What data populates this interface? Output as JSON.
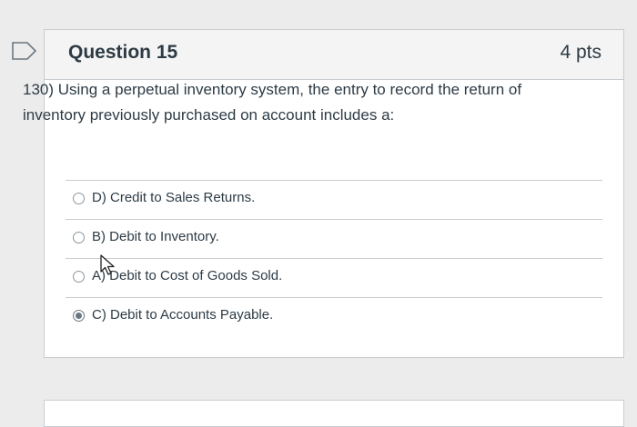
{
  "question": {
    "title": "Question 15",
    "points": "4 pts",
    "text": "130) Using a perpetual inventory system, the entry to record the return of inventory previously purchased on account includes a:",
    "answers": [
      {
        "label": "D) Credit to Sales Returns.",
        "selected": false
      },
      {
        "label": "B) Debit to Inventory.",
        "selected": false
      },
      {
        "label": "A) Debit to Cost of Goods Sold.",
        "selected": false
      },
      {
        "label": "C) Debit to Accounts Payable.",
        "selected": true
      }
    ]
  },
  "icons": {
    "flag": "flag-icon",
    "cursor": "mouse-pointer-icon"
  },
  "colors": {
    "text": "#2d3b45",
    "border": "#c7cdd1",
    "header_bg": "#f4f4f4",
    "page_bg": "#ececec"
  }
}
